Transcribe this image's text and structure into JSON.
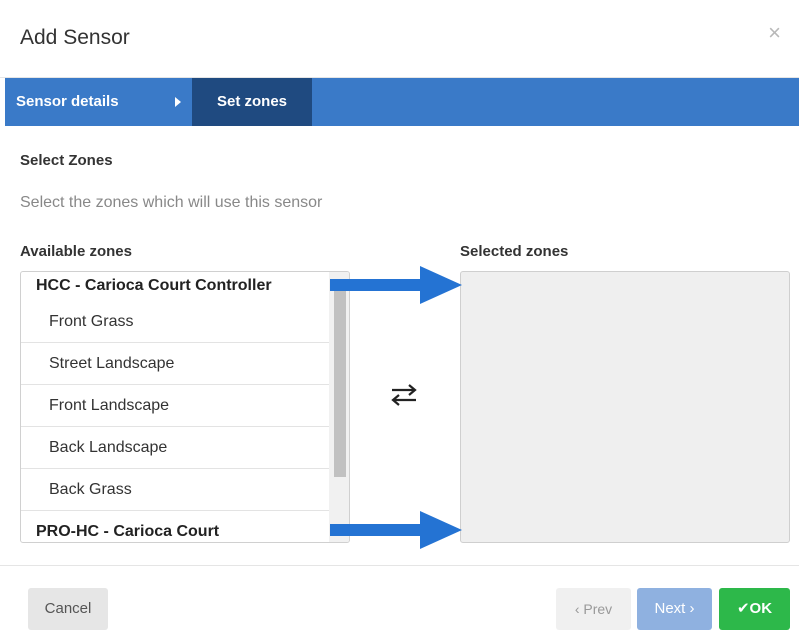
{
  "dialog": {
    "title": "Add Sensor",
    "close_glyph": "×"
  },
  "wizard": {
    "steps": [
      {
        "label": "Sensor details"
      },
      {
        "label": "Set zones"
      }
    ],
    "active_step": "Set zones"
  },
  "section": {
    "title": "Select Zones",
    "description": "Select the zones which will use this sensor"
  },
  "available": {
    "label": "Available zones",
    "groups": [
      {
        "name": "HCC - Carioca Court Controller",
        "zones": [
          "Front Grass",
          "Street Landscape",
          "Front Landscape",
          "Back Landscape",
          "Back Grass"
        ]
      },
      {
        "name": "PRO-HC - Carioca Court",
        "zones": []
      }
    ]
  },
  "selected": {
    "label": "Selected zones",
    "zones": []
  },
  "transfer": {
    "icon": "transfer-icon"
  },
  "footer": {
    "cancel_label": "Cancel",
    "prev_label": "‹ Prev",
    "next_label": "Next ›",
    "ok_check": "✔",
    "ok_label": "OK"
  },
  "colors": {
    "wizard_bar": "#3a7ac8",
    "wizard_active": "#1f4a80",
    "ok_button": "#2db84a",
    "next_button": "#8fb1e0",
    "callout_arrow": "#2473d3"
  }
}
